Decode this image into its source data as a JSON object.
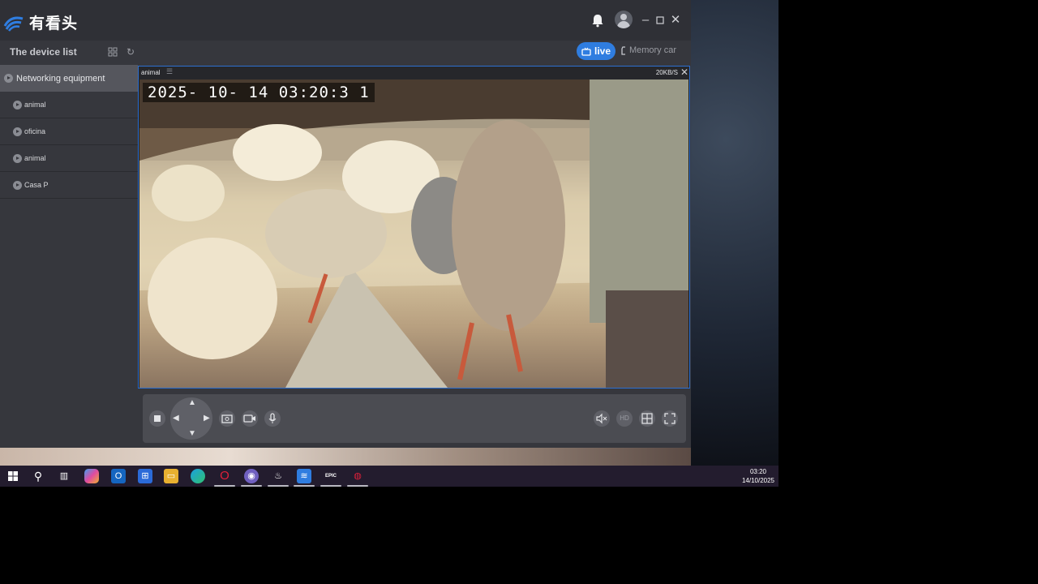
{
  "app": {
    "logo_text": "有看头",
    "title_controls": [
      "minimize",
      "maximize",
      "close"
    ]
  },
  "toolbar": {
    "device_list_title": "The device list",
    "live_label": "live",
    "memory_label": "Memory car"
  },
  "sidebar": {
    "group_label": "Networking equipment",
    "items": [
      {
        "label": "animal"
      },
      {
        "label": "oficina"
      },
      {
        "label": "animal"
      },
      {
        "label": "Casa P"
      }
    ]
  },
  "video": {
    "channel_name": "animal",
    "bitrate": "20KB/S",
    "osd_timestamp": "2025- 10- 14   03:20:3 1"
  },
  "controls": {
    "left": [
      "stop-icon",
      "ptz-dpad",
      "screenshot-icon",
      "record-icon",
      "microphone-icon"
    ],
    "right_hd_label": "HD"
  },
  "taskbar": {
    "time": "03:20",
    "date": "14/10/2025",
    "epic_label": "EPIC"
  },
  "colors": {
    "accent": "#2f7de0",
    "window_bg": "#36373d",
    "titlebar_bg": "#2f3036",
    "selected_group_bg": "#55565d"
  }
}
